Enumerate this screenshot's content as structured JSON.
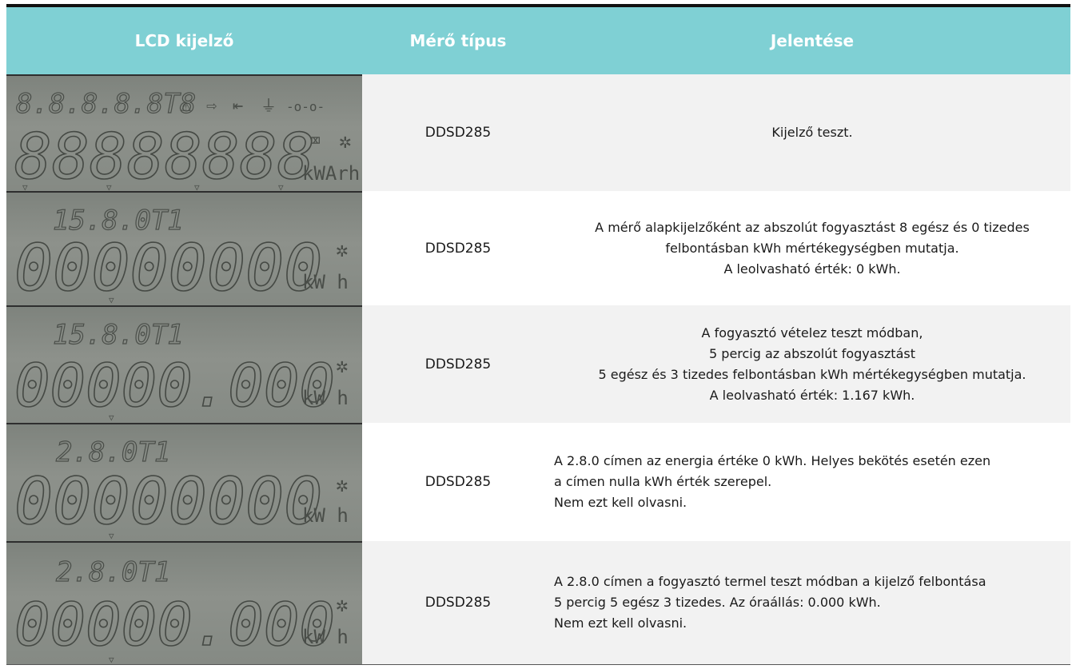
{
  "header": {
    "col1": "LCD kijelző",
    "col2": "Mérő típus",
    "col3": "Jelentése",
    "color": "#7fd0d4"
  },
  "rows": [
    {
      "lcd_top": "8.8.8.8.8T8",
      "lcd_main": "88888888",
      "lcd_unit": "kWArh",
      "type": "DDSD285",
      "meaning": [
        "Kijelző teszt."
      ]
    },
    {
      "lcd_top": "15.8.0T1",
      "lcd_main": "00000000",
      "lcd_unit": "kW h",
      "type": "DDSD285",
      "meaning": [
        "A mérő alapkijelzőként az abszolút fogyasztást 8 egész és 0 tizedes",
        "felbontásban kWh mértékegységben mutatja.",
        "A leolvasható érték: 0 kWh."
      ]
    },
    {
      "lcd_top": "15.8.0T1",
      "lcd_main": "00000.000",
      "lcd_unit": "kW h",
      "type": "DDSD285",
      "meaning": [
        "A  fogyasztó vételez teszt módban,",
        "5 percig az abszolút fogyasztást",
        "5 egész és 3 tizedes felbontásban kWh mértékegységben mutatja.",
        "A leolvasható érték: 1.167 kWh."
      ]
    },
    {
      "lcd_top": "2.8.0T1",
      "lcd_main": "00000000",
      "lcd_unit": "kW h",
      "type": "DDSD285",
      "meaning": [
        "A 2.8.0 címen az energia értéke 0 kWh. Helyes bekötés esetén ezen",
        "a címen nulla kWh érték szerepel.",
        "Nem ezt kell olvasni."
      ]
    },
    {
      "lcd_top": "2.8.0T1",
      "lcd_main": "00000.000",
      "lcd_unit": "kW h",
      "type": "DDSD285",
      "meaning": [
        "A 2.8.0 címen a fogyasztó termel teszt módban a kijelző felbontása",
        "5 percig 5 egész 3 tizedes. Az óraállás: 0.000 kWh.",
        "Nem ezt kell olvasni."
      ]
    }
  ]
}
